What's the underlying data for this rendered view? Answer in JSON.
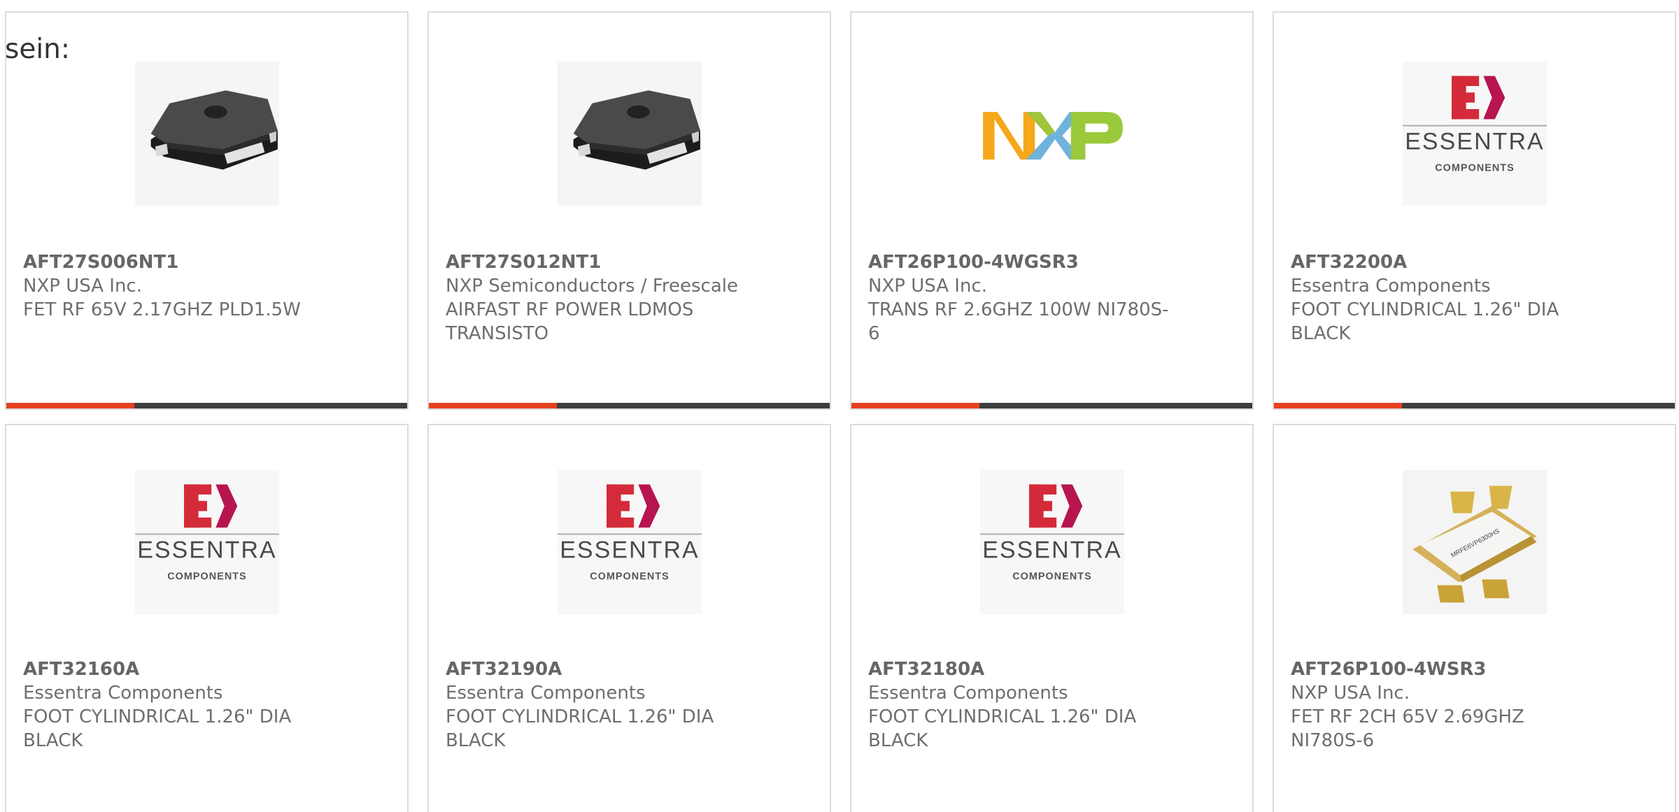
{
  "intro_text": "sein:",
  "accent_progress_fraction": 0.32,
  "colors": {
    "accent": "#e8411f",
    "bar_dark": "#3d3d3d",
    "card_border": "#dcdcdc",
    "text": "#6e6e6e"
  },
  "products": [
    {
      "part": "AFT27S006NT1",
      "manufacturer": "NXP USA Inc.",
      "description": "FET RF 65V 2.17GHZ PLD1.5W",
      "image": "rf-transistor-chip-image"
    },
    {
      "part": "AFT27S012NT1",
      "manufacturer": "NXP Semiconductors / Freescale",
      "description": "AIRFAST RF POWER LDMOS TRANSISTO",
      "image": "rf-transistor-chip-image"
    },
    {
      "part": "AFT26P100-4WGSR3",
      "manufacturer": "NXP USA Inc.",
      "description": "TRANS RF 2.6GHZ 100W NI780S-6",
      "image": "nxp-logo"
    },
    {
      "part": "AFT32200A",
      "manufacturer": "Essentra Components",
      "description": "FOOT CYLINDRICAL 1.26\" DIA BLACK",
      "image": "essentra-logo"
    },
    {
      "part": "AFT32160A",
      "manufacturer": "Essentra Components",
      "description": "FOOT CYLINDRICAL 1.26\" DIA BLACK",
      "image": "essentra-logo"
    },
    {
      "part": "AFT32190A",
      "manufacturer": "Essentra Components",
      "description": "FOOT CYLINDRICAL 1.26\" DIA BLACK",
      "image": "essentra-logo"
    },
    {
      "part": "AFT32180A",
      "manufacturer": "Essentra Components",
      "description": "FOOT CYLINDRICAL 1.26\" DIA BLACK",
      "image": "essentra-logo"
    },
    {
      "part": "AFT26P100-4WSR3",
      "manufacturer": "NXP USA Inc.",
      "description": "FET RF 2CH 65V 2.69GHZ NI780S-6",
      "image": "rf-flange-transistor-image"
    }
  ],
  "logos": {
    "nxp_letters": [
      "N",
      "X",
      "P"
    ],
    "essentra_mark": "E",
    "essentra_name": "ESSENTRA",
    "essentra_sub": "COMPONENTS",
    "chip_marking": "MRFE6VP6300HS"
  }
}
